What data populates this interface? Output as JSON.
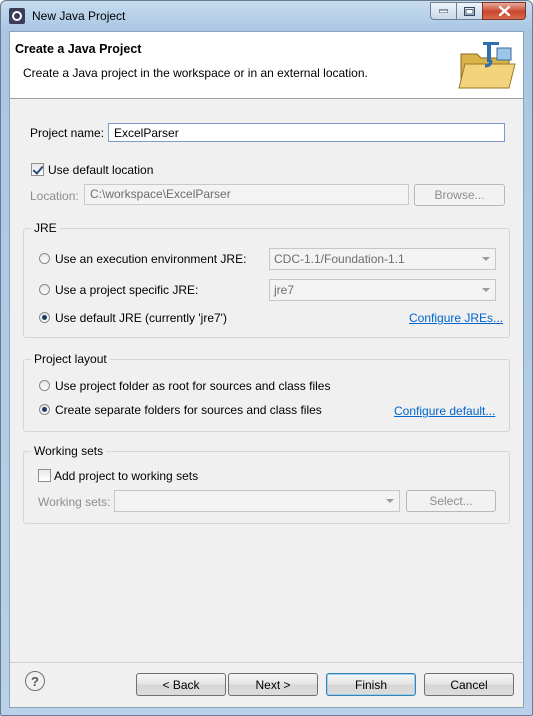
{
  "window": {
    "title": "New Java Project"
  },
  "header": {
    "title": "Create a Java Project",
    "description": "Create a Java project in the workspace or in an external location."
  },
  "project": {
    "name_label": "Project name:",
    "name_value": "ExcelParser",
    "use_default_location_label": "Use default location",
    "use_default_location_checked": true,
    "location_label": "Location:",
    "location_value": "C:\\workspace\\ExcelParser",
    "browse_label": "Browse..."
  },
  "jre": {
    "group_label": "JRE",
    "option_env_label": "Use an execution environment JRE:",
    "option_env_value": "CDC-1.1/Foundation-1.1",
    "option_specific_label": "Use a project specific JRE:",
    "option_specific_value": "jre7",
    "option_default_label": "Use default JRE (currently 'jre7')",
    "selected": "default",
    "configure_link": "Configure JREs..."
  },
  "layout": {
    "group_label": "Project layout",
    "option_root_label": "Use project folder as root for sources and class files",
    "option_separate_label": "Create separate folders for sources and class files",
    "selected": "separate",
    "configure_link": "Configure default..."
  },
  "working_sets": {
    "group_label": "Working sets",
    "add_label": "Add project to working sets",
    "add_checked": false,
    "sets_label": "Working sets:",
    "sets_value": "",
    "select_label": "Select..."
  },
  "footer": {
    "back_label": "< Back",
    "next_label": "Next >",
    "finish_label": "Finish",
    "cancel_label": "Cancel",
    "help_icon": "?"
  },
  "icons": {
    "app": "eclipse-icon",
    "header": "java-project-folder-icon",
    "help": "help-icon"
  }
}
